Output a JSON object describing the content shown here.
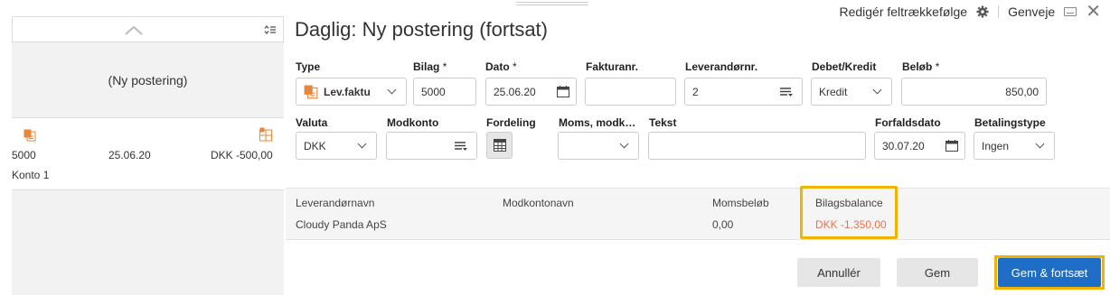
{
  "toplinks": {
    "edit_tab_order": "Redigér feltrækkefølge",
    "shortcuts": "Genveje"
  },
  "sidebar": {
    "new_posting": "(Ny postering)",
    "entry": {
      "voucher": "5000",
      "date": "25.06.20",
      "amount": "DKK -500,00",
      "account": "Konto 1"
    }
  },
  "title": "Daglig: Ny postering (fortsat)",
  "form": {
    "type": {
      "label": "Type",
      "value": "Lev.faktu"
    },
    "voucher": {
      "label": "Bilag",
      "required": "*",
      "value": "5000"
    },
    "date": {
      "label": "Dato",
      "required": "*",
      "value": "25.06.20"
    },
    "invoice_no": {
      "label": "Fakturanr.",
      "value": ""
    },
    "supplier_no": {
      "label": "Leverandørnr.",
      "value": "2"
    },
    "debit_credit": {
      "label": "Debet/Kredit",
      "value": "Kredit"
    },
    "amount": {
      "label": "Beløb",
      "required": "*",
      "value": "850,00"
    },
    "currency": {
      "label": "Valuta",
      "value": "DKK"
    },
    "contra_account": {
      "label": "Modkonto",
      "value": ""
    },
    "distribution": {
      "label": "Fordeling"
    },
    "vat": {
      "label": "Moms, modk…",
      "value": ""
    },
    "text": {
      "label": "Tekst",
      "value": ""
    },
    "due_date": {
      "label": "Forfaldsdato",
      "value": "30.07.20"
    },
    "payment_type": {
      "label": "Betalingstype",
      "value": "Ingen"
    }
  },
  "summary": {
    "supplier_name_label": "Leverandørnavn",
    "supplier_name": "Cloudy Panda ApS",
    "contra_name_label": "Modkontonavn",
    "vat_amount_label": "Momsbeløb",
    "vat_amount": "0,00",
    "balance_label": "Bilagsbalance",
    "balance": "DKK -1.350,00"
  },
  "buttons": {
    "cancel": "Annullér",
    "save": "Gem",
    "save_continue": "Gem & fortsæt"
  },
  "colors": {
    "accent": "#1e6ec8",
    "highlight": "#f0b400",
    "negative": "#e8734a",
    "icon_orange": "#e8873a"
  }
}
